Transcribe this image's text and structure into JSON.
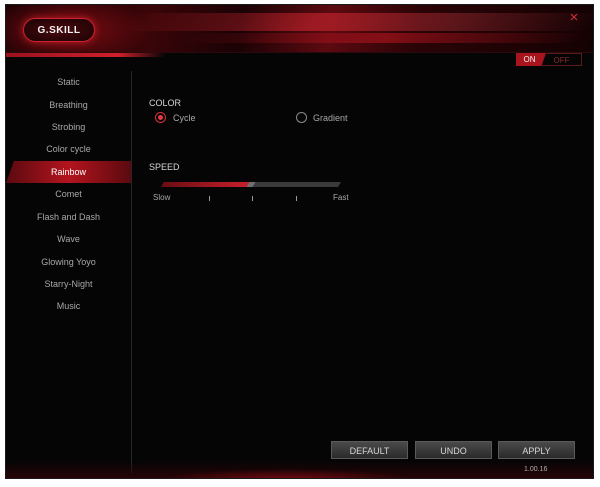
{
  "app": {
    "logo_text": "G.SKILL",
    "close_glyph": "×",
    "version": "1.00.16"
  },
  "power_toggle": {
    "on_label": "ON",
    "off_label": "OFF",
    "state": "on"
  },
  "sidebar": {
    "items": [
      {
        "label": "Static"
      },
      {
        "label": "Breathing"
      },
      {
        "label": "Strobing"
      },
      {
        "label": "Color cycle"
      },
      {
        "label": "Rainbow",
        "active": true
      },
      {
        "label": "Comet"
      },
      {
        "label": "Flash and Dash"
      },
      {
        "label": "Wave"
      },
      {
        "label": "Glowing Yoyo"
      },
      {
        "label": "Starry-Night"
      },
      {
        "label": "Music"
      }
    ]
  },
  "color": {
    "label": "COLOR",
    "options": [
      {
        "label": "Cycle",
        "checked": true
      },
      {
        "label": "Gradient",
        "checked": false
      }
    ]
  },
  "speed": {
    "label": "SPEED",
    "min_label": "Slow",
    "max_label": "Fast",
    "value_fraction": 0.5
  },
  "buttons": {
    "default_label": "DEFAULT",
    "undo_label": "UNDO",
    "apply_label": "APPLY"
  },
  "colors": {
    "accent_red": "#c8202c",
    "background": "#050505"
  }
}
